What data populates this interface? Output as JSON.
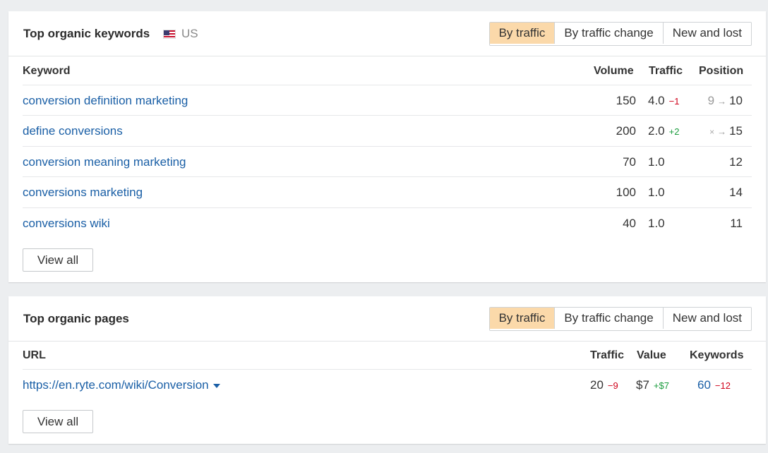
{
  "keywords_card": {
    "title": "Top organic keywords",
    "country": "US",
    "tabs": [
      "By traffic",
      "By traffic change",
      "New and lost"
    ],
    "active_tab": 0,
    "columns": {
      "keyword": "Keyword",
      "volume": "Volume",
      "traffic": "Traffic",
      "position": "Position"
    },
    "rows": [
      {
        "keyword": "conversion definition marketing",
        "volume": "150",
        "traffic": "4.0",
        "traffic_delta": "−1",
        "pos_from": "9",
        "pos_to": "10"
      },
      {
        "keyword": "define conversions",
        "volume": "200",
        "traffic": "2.0",
        "traffic_delta": "+2",
        "pos_from": "×",
        "pos_to": "15"
      },
      {
        "keyword": "conversion meaning marketing",
        "volume": "70",
        "traffic": "1.0",
        "traffic_delta": "",
        "pos_from": "",
        "pos_to": "12"
      },
      {
        "keyword": "conversions marketing",
        "volume": "100",
        "traffic": "1.0",
        "traffic_delta": "",
        "pos_from": "",
        "pos_to": "14"
      },
      {
        "keyword": "conversions wiki",
        "volume": "40",
        "traffic": "1.0",
        "traffic_delta": "",
        "pos_from": "",
        "pos_to": "11"
      }
    ],
    "view_all": "View all",
    "arrow": "→"
  },
  "pages_card": {
    "title": "Top organic pages",
    "tabs": [
      "By traffic",
      "By traffic change",
      "New and lost"
    ],
    "active_tab": 0,
    "columns": {
      "url": "URL",
      "traffic": "Traffic",
      "value": "Value",
      "keywords": "Keywords"
    },
    "rows": [
      {
        "url": "https://en.ryte.com/wiki/Conversion",
        "traffic": "20",
        "traffic_delta": "−9",
        "value": "$7",
        "value_delta": "+$7",
        "keywords": "60",
        "keywords_delta": "−12"
      }
    ],
    "view_all": "View all"
  },
  "colors": {
    "link": "#1a5fa6",
    "active_tab": "#fbd9aa",
    "negative": "#d0021b",
    "positive": "#1a9c3d"
  }
}
